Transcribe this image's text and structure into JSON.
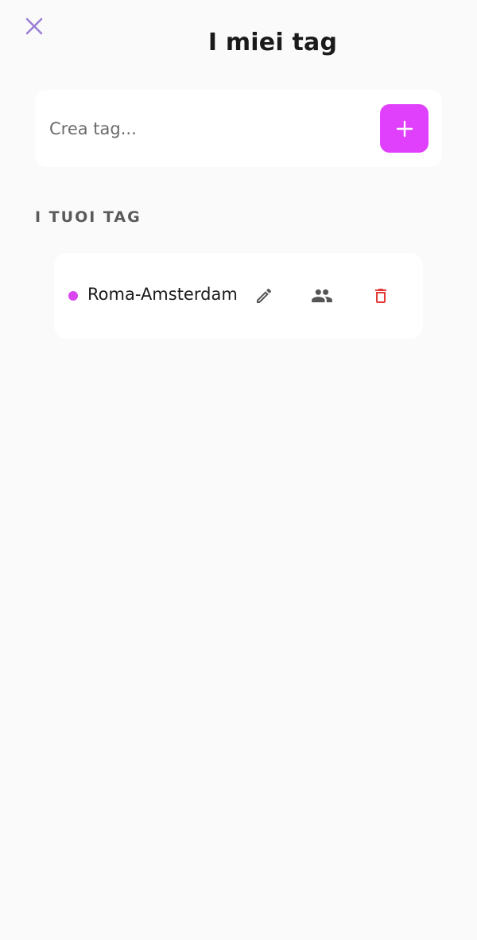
{
  "header": {
    "title": "I miei tag",
    "close_icon": "close-icon"
  },
  "create": {
    "placeholder": "Crea tag...",
    "value": "",
    "add_icon": "plus-icon",
    "accent_color": "#e040fb"
  },
  "section": {
    "label": "I TUOI TAG"
  },
  "tags": [
    {
      "name": "Roma-Amsterdam",
      "dot_color": "#d946ef",
      "actions": [
        "pencil-icon",
        "people-icon",
        "trash-icon"
      ]
    }
  ],
  "colors": {
    "background": "#fafafa",
    "close_icon": "#9b7fd4",
    "delete_icon": "#e53935",
    "action_icon": "#555555"
  }
}
